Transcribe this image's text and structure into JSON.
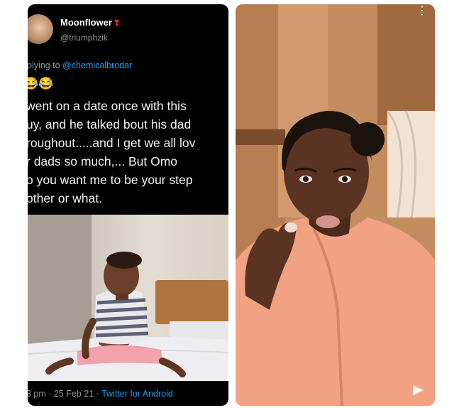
{
  "tweet": {
    "display_name": "Moonflower",
    "name_emoji": "❣",
    "handle": "@triumphzik",
    "replying_prefix": "plying to ",
    "replying_mention": "@chemicalbrodar",
    "emojis": "😂😂",
    "lines": [
      "went on a date once with this",
      "uy, and he talked bout his dad",
      "roughout.....and I get we all lov",
      "r dads so much,... But Omo",
      "o you want me to be your step",
      "other or what."
    ],
    "timestamp": "3 pm · 25 Feb 21 · ",
    "source": "Twitter for Android",
    "media_icon": "child-sitting-on-bed-photo"
  },
  "photo": {
    "subject_icon": "woman-portrait-photo",
    "menu_icon": "vertical-dots-icon",
    "play_icon": "play-icon"
  },
  "colors": {
    "tweet_background": "#000000",
    "secondary_text": "#8b98a5",
    "link_blue": "#1d9bf0",
    "shirt_peach": "#f0a283",
    "wall_brown": "#c48d60"
  }
}
